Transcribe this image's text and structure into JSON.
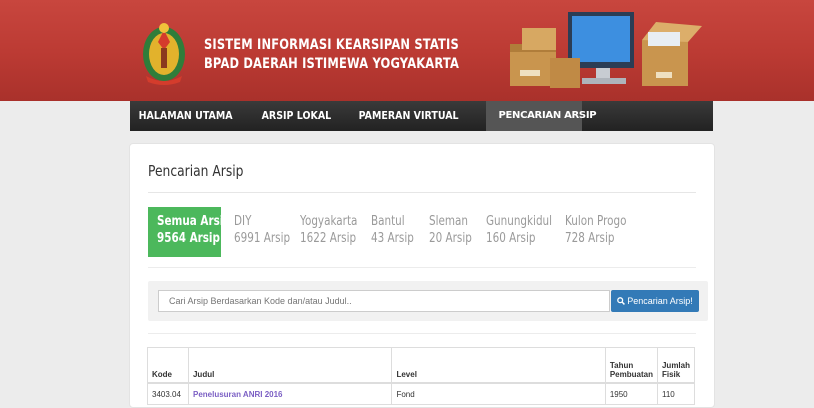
{
  "header": {
    "title_line1": "SISTEM INFORMASI KEARSIPAN STATIS",
    "title_line2": "BPAD DAERAH ISTIMEWA YOGYAKARTA"
  },
  "nav": {
    "items": [
      {
        "label": "HALAMAN UTAMA"
      },
      {
        "label": "ARSIP LOKAL"
      },
      {
        "label": "PAMERAN VIRTUAL"
      },
      {
        "label": "PENCARIAN ARSIP"
      }
    ]
  },
  "page": {
    "title": "Pencarian Arsip"
  },
  "filters": [
    {
      "name": "Semua Arsip",
      "count": "9564 Arsip"
    },
    {
      "name": "DIY",
      "count": "6991 Arsip"
    },
    {
      "name": "Yogyakarta",
      "count": "1622 Arsip"
    },
    {
      "name": "Bantul",
      "count": "43 Arsip"
    },
    {
      "name": "Sleman",
      "count": "20 Arsip"
    },
    {
      "name": "Gunungkidul",
      "count": "160 Arsip"
    },
    {
      "name": "Kulon Progo",
      "count": "728 Arsip"
    }
  ],
  "search": {
    "placeholder": "Cari Arsip Berdasarkan Kode dan/atau Judul..",
    "button_label": "Pencarian Arsip!"
  },
  "table": {
    "headers": {
      "kode": "Kode",
      "judul": "Judul",
      "level": "Level",
      "tahun": "Tahun Pembuatan",
      "jumlah": "Jumlah Fisik"
    },
    "rows": [
      {
        "kode": "3403.04",
        "judul": "Penelusuran ANRI 2016",
        "level": "Fond",
        "tahun": "1950",
        "jumlah": "110"
      }
    ]
  },
  "colors": {
    "header_red": "#bb3a33",
    "active_filter_green": "#4cb85c",
    "button_blue": "#337ab7",
    "link_purple": "#7b5fc4"
  }
}
